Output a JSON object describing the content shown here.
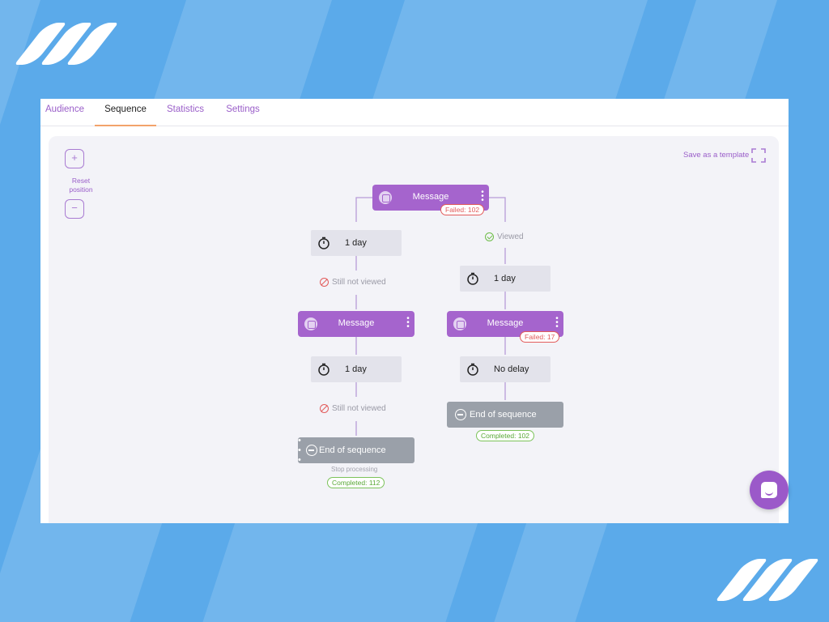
{
  "tabs": [
    {
      "label": "Audience"
    },
    {
      "label": "Sequence"
    },
    {
      "label": "Statistics"
    },
    {
      "label": "Settings"
    }
  ],
  "active_tab": "Sequence",
  "toolbar": {
    "zoom_in": "+",
    "reset_label": "Reset position",
    "zoom_out": "−",
    "save_template": "Save as a template"
  },
  "flow": {
    "root_message": {
      "label": "Message",
      "failed": "Failed: 102"
    },
    "left": {
      "delay1": "1 day",
      "cond1": "Still not viewed",
      "message": {
        "label": "Message"
      },
      "delay2": "1 day",
      "cond2": "Still not viewed",
      "end": "End of sequence",
      "stop": "Stop processing",
      "completed": "Completed: 112"
    },
    "right": {
      "cond": "Viewed",
      "delay1": "1 day",
      "message": {
        "label": "Message",
        "failed": "Failed: 17"
      },
      "delay2": "No delay",
      "end": "End of sequence",
      "completed": "Completed: 102"
    }
  },
  "colors": {
    "background": "#5baaea",
    "accent": "#a564cd",
    "delay_node": "#e3e3eb",
    "end_node": "#9aa0a9",
    "failed": "#e25b5b",
    "completed": "#59a836",
    "active_tab_underline": "#f2a36b"
  },
  "icons": [
    "logo-mark",
    "message-icon",
    "more-dots-icon",
    "timer-icon",
    "not-viewed-icon",
    "viewed-check-icon",
    "end-icon",
    "fullscreen-icon",
    "chat-icon"
  ]
}
